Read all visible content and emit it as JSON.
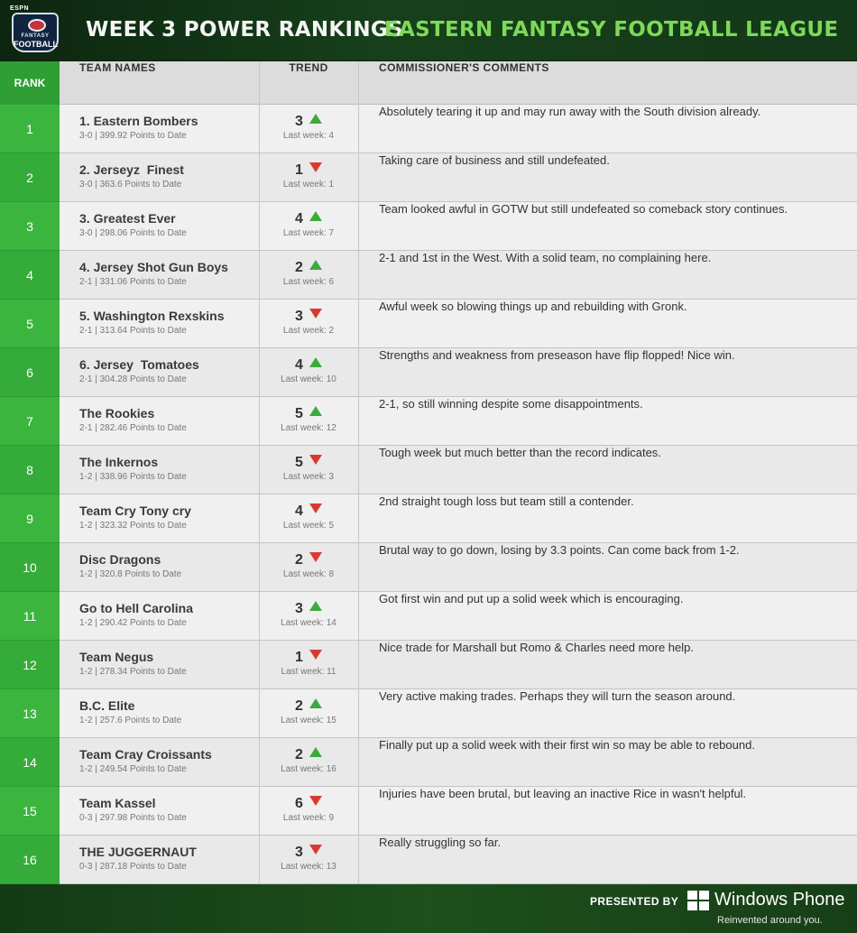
{
  "header": {
    "logo": {
      "brand": "ESPN",
      "line1": "FANTASY",
      "line2": "FOOTBALL"
    },
    "title": "WEEK 3 POWER RANKINGS",
    "league": "EASTERN FANTASY FOOTBALL LEAGUE"
  },
  "columns": {
    "rank": "RANK",
    "team": "TEAM NAMES",
    "trend": "TREND",
    "comments": "COMMISSIONER'S COMMENTS"
  },
  "colors": {
    "up": "#3caa3c",
    "down": "#d93a30",
    "rank_bg": "#3cb53f"
  },
  "rows": [
    {
      "rank": "1",
      "team": "1. Eastern Bombers",
      "record": "3-0 | 399.92 Points to Date",
      "trend": "3",
      "direction": "up",
      "last": "Last week: 4",
      "comment": "Absolutely tearing it up and may run away with the South division already."
    },
    {
      "rank": "2",
      "team": "2. Jerseyz  Finest",
      "record": "3-0 | 363.6 Points to Date",
      "trend": "1",
      "direction": "down",
      "last": "Last week: 1",
      "comment": "Taking care of business and still undefeated."
    },
    {
      "rank": "3",
      "team": "3. Greatest Ever",
      "record": "3-0 | 298.06 Points to Date",
      "trend": "4",
      "direction": "up",
      "last": "Last week: 7",
      "comment": "Team looked awful in GOTW but still undefeated so comeback story continues."
    },
    {
      "rank": "4",
      "team": "4. Jersey Shot Gun Boys",
      "record": "2-1 | 331.06 Points to Date",
      "trend": "2",
      "direction": "up",
      "last": "Last week: 6",
      "comment": "2-1 and 1st in the West. With a solid team, no complaining here."
    },
    {
      "rank": "5",
      "team": "5. Washington Rexskins",
      "record": "2-1 | 313.64 Points to Date",
      "trend": "3",
      "direction": "down",
      "last": "Last week: 2",
      "comment": "Awful week so blowing things up and rebuilding with Gronk."
    },
    {
      "rank": "6",
      "team": "6. Jersey  Tomatoes",
      "record": "2-1 | 304.28 Points to Date",
      "trend": "4",
      "direction": "up",
      "last": "Last week: 10",
      "comment": "Strengths and weakness from preseason have flip flopped! Nice win."
    },
    {
      "rank": "7",
      "team": "The Rookies",
      "record": "2-1 | 282.46 Points to Date",
      "trend": "5",
      "direction": "up",
      "last": "Last week: 12",
      "comment": "2-1, so still winning despite some disappointments."
    },
    {
      "rank": "8",
      "team": "The Inkernos",
      "record": "1-2 | 338.96 Points to Date",
      "trend": "5",
      "direction": "down",
      "last": "Last week: 3",
      "comment": "Tough week but much better than the record indicates."
    },
    {
      "rank": "9",
      "team": "Team Cry Tony cry",
      "record": "1-2 | 323.32 Points to Date",
      "trend": "4",
      "direction": "down",
      "last": "Last week: 5",
      "comment": "2nd straight tough loss but team still a contender."
    },
    {
      "rank": "10",
      "team": "Disc Dragons",
      "record": "1-2 | 320.8 Points to Date",
      "trend": "2",
      "direction": "down",
      "last": "Last week: 8",
      "comment": "Brutal way to go down, losing by 3.3 points. Can come back from 1-2."
    },
    {
      "rank": "11",
      "team": "Go to Hell Carolina",
      "record": "1-2 | 290.42 Points to Date",
      "trend": "3",
      "direction": "up",
      "last": "Last week: 14",
      "comment": "Got first win and put up a solid week which is encouraging."
    },
    {
      "rank": "12",
      "team": "Team Negus",
      "record": "1-2 | 278.34 Points to Date",
      "trend": "1",
      "direction": "down",
      "last": "Last week: 11",
      "comment": "Nice trade for Marshall but Romo & Charles need more help."
    },
    {
      "rank": "13",
      "team": "B.C. Elite",
      "record": "1-2 | 257.6 Points to Date",
      "trend": "2",
      "direction": "up",
      "last": "Last week: 15",
      "comment": "Very active making trades. Perhaps they will turn the season around."
    },
    {
      "rank": "14",
      "team": "Team Cray Croissants",
      "record": "1-2 | 249.54 Points to Date",
      "trend": "2",
      "direction": "up",
      "last": "Last week: 16",
      "comment": "Finally put up a solid week with their first win so may be able to rebound."
    },
    {
      "rank": "15",
      "team": "Team Kassel",
      "record": "0-3 | 297.98 Points to Date",
      "trend": "6",
      "direction": "down",
      "last": "Last week: 9",
      "comment": "Injuries have been brutal, but leaving an inactive Rice in wasn't helpful."
    },
    {
      "rank": "16",
      "team": "THE JUGGERNAUT",
      "record": "0-3 | 287.18 Points to Date",
      "trend": "3",
      "direction": "down",
      "last": "Last week: 13",
      "comment": "Really struggling so far."
    }
  ],
  "footer": {
    "presented": "PRESENTED BY",
    "brand": "Windows Phone",
    "tagline": "Reinvented around you."
  }
}
